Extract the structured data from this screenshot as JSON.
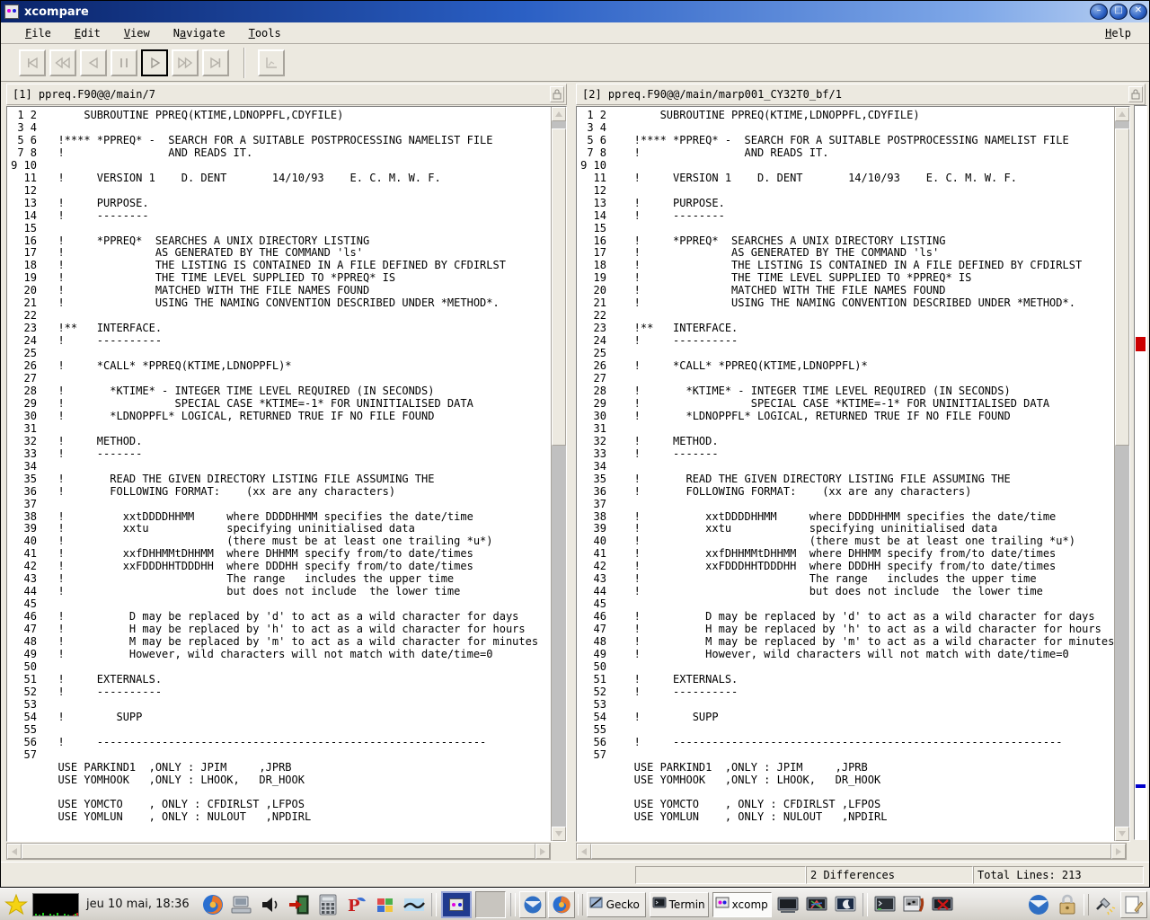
{
  "window": {
    "title": "xcompare",
    "icon": "xcompare-icon",
    "minimize_label": "–",
    "maximize_label": "□",
    "close_label": "✕"
  },
  "menubar": {
    "items": [
      {
        "label": "File",
        "mnemonic": "F",
        "name": "menu-file"
      },
      {
        "label": "Edit",
        "mnemonic": "E",
        "name": "menu-edit"
      },
      {
        "label": "View",
        "mnemonic": "V",
        "name": "menu-view"
      },
      {
        "label": "Navigate",
        "mnemonic": "a",
        "name": "menu-navigate"
      },
      {
        "label": "Tools",
        "mnemonic": "T",
        "name": "menu-tools"
      }
    ],
    "help": {
      "label": "Help",
      "mnemonic": "H",
      "name": "menu-help"
    }
  },
  "toolbar": {
    "buttons": [
      {
        "name": "first-difference-button",
        "icon": "skip-to-start-icon",
        "enabled": false,
        "active": false
      },
      {
        "name": "previous-page-button",
        "icon": "rewind-icon",
        "enabled": false,
        "active": false
      },
      {
        "name": "previous-difference-button",
        "icon": "prev-icon",
        "enabled": false,
        "active": false
      },
      {
        "name": "pause-button",
        "icon": "pause-icon",
        "enabled": false,
        "active": false
      },
      {
        "name": "next-difference-button",
        "icon": "play-icon",
        "enabled": true,
        "active": true
      },
      {
        "name": "next-page-button",
        "icon": "fast-forward-icon",
        "enabled": false,
        "active": false
      },
      {
        "name": "last-difference-button",
        "icon": "skip-to-end-icon",
        "enabled": false,
        "active": false
      },
      {
        "name": "statistics-button",
        "icon": "chart-icon",
        "enabled": false,
        "active": false
      }
    ]
  },
  "panes": [
    {
      "id": "left",
      "name": "pane-left",
      "title": "[1] ppreq.F90@@/main/7",
      "lock_icon": "lock-icon",
      "scroll": {
        "thumb_top_pct": 1,
        "thumb_height_pct": 45
      },
      "first_line": 1,
      "lines": [
        "      SUBROUTINE PPREQ(KTIME,LDNOPPFL,CDYFILE)",
        "",
        "  !**** *PPREQ* -  SEARCH FOR A SUITABLE POSTPROCESSING NAMELIST FILE",
        "  !                AND READS IT.",
        "",
        "  !     VERSION 1    D. DENT       14/10/93    E. C. M. W. F.",
        "",
        "  !     PURPOSE.",
        "  !     --------",
        "",
        "  !     *PPREQ*  SEARCHES A UNIX DIRECTORY LISTING",
        "  !              AS GENERATED BY THE COMMAND 'ls'",
        "  !              THE LISTING IS CONTAINED IN A FILE DEFINED BY CFDIRLST",
        "  !              THE TIME LEVEL SUPPLIED TO *PPREQ* IS",
        "  !              MATCHED WITH THE FILE NAMES FOUND",
        "  !              USING THE NAMING CONVENTION DESCRIBED UNDER *METHOD*.",
        "",
        "  !**   INTERFACE.",
        "  !     ----------",
        "",
        "  !     *CALL* *PPREQ(KTIME,LDNOPPFL)*",
        "",
        "  !       *KTIME* - INTEGER TIME LEVEL REQUIRED (IN SECONDS)",
        "  !                 SPECIAL CASE *KTIME=-1* FOR UNINITIALISED DATA",
        "  !       *LDNOPPFL* LOGICAL, RETURNED TRUE IF NO FILE FOUND",
        "",
        "  !     METHOD.",
        "  !     -------",
        "",
        "  !       READ THE GIVEN DIRECTORY LISTING FILE ASSUMING THE",
        "  !       FOLLOWING FORMAT:    (xx are any characters)",
        "",
        "  !         xxtDDDDHHMM     where DDDDHHMM specifies the date/time",
        "  !         xxtu            specifying uninitialised data",
        "  !                         (there must be at least one trailing *u*)",
        "  !         xxfDHHMMtDHHMM  where DHHMM specify from/to date/times",
        "  !         xxFDDDHHTDDDHH  where DDDHH specify from/to date/times",
        "  !                         The range   includes the upper time",
        "  !                         but does not include  the lower time",
        "",
        "  !          D may be replaced by 'd' to act as a wild character for days",
        "  !          H may be replaced by 'h' to act as a wild character for hours",
        "  !          M may be replaced by 'm' to act as a wild character for minutes",
        "  !          However, wild characters will not match with date/time=0",
        "",
        "  !     EXTERNALS.",
        "  !     ----------",
        "",
        "  !        SUPP",
        "",
        "  !     ------------------------------------------------------------",
        "",
        "  USE PARKIND1  ,ONLY : JPIM     ,JPRB",
        "  USE YOMHOOK   ,ONLY : LHOOK,   DR_HOOK",
        "",
        "  USE YOMCTO    , ONLY : CFDIRLST ,LFPOS",
        "  USE YOMLUN    , ONLY : NULOUT   ,NPDIRL"
      ]
    },
    {
      "id": "right",
      "name": "pane-right",
      "title": "[2] ppreq.F90@@/main/marp001_CY32T0_bf/1",
      "lock_icon": "lock-icon",
      "scroll": {
        "thumb_top_pct": 1,
        "thumb_height_pct": 45
      },
      "first_line": 1,
      "lines": [
        "       SUBROUTINE PPREQ(KTIME,LDNOPPFL,CDYFILE)",
        "",
        "   !**** *PPREQ* -  SEARCH FOR A SUITABLE POSTPROCESSING NAMELIST FILE",
        "   !                AND READS IT.",
        "",
        "   !     VERSION 1    D. DENT       14/10/93    E. C. M. W. F.",
        "",
        "   !     PURPOSE.",
        "   !     --------",
        "",
        "   !     *PPREQ*  SEARCHES A UNIX DIRECTORY LISTING",
        "   !              AS GENERATED BY THE COMMAND 'ls'",
        "   !              THE LISTING IS CONTAINED IN A FILE DEFINED BY CFDIRLST",
        "   !              THE TIME LEVEL SUPPLIED TO *PPREQ* IS",
        "   !              MATCHED WITH THE FILE NAMES FOUND",
        "   !              USING THE NAMING CONVENTION DESCRIBED UNDER *METHOD*.",
        "",
        "   !**   INTERFACE.",
        "   !     ----------",
        "",
        "   !     *CALL* *PPREQ(KTIME,LDNOPPFL)*",
        "",
        "   !       *KTIME* - INTEGER TIME LEVEL REQUIRED (IN SECONDS)",
        "   !                 SPECIAL CASE *KTIME=-1* FOR UNINITIALISED DATA",
        "   !       *LDNOPPFL* LOGICAL, RETURNED TRUE IF NO FILE FOUND",
        "",
        "   !     METHOD.",
        "   !     -------",
        "",
        "   !       READ THE GIVEN DIRECTORY LISTING FILE ASSUMING THE",
        "   !       FOLLOWING FORMAT:    (xx are any characters)",
        "",
        "   !          xxtDDDDHHMM     where DDDDHHMM specifies the date/time",
        "   !          xxtu            specifying uninitialised data",
        "   !                          (there must be at least one trailing *u*)",
        "   !          xxfDHHMMtDHHMM  where DHHMM specify from/to date/times",
        "   !          xxFDDDHHTDDDHH  where DDDHH specify from/to date/times",
        "   !                          The range   includes the upper time",
        "   !                          but does not include  the lower time",
        "",
        "   !          D may be replaced by 'd' to act as a wild character for days",
        "   !          H may be replaced by 'h' to act as a wild character for hours",
        "   !          M may be replaced by 'm' to act as a wild character for minutes",
        "   !          However, wild characters will not match with date/time=0",
        "",
        "   !     EXTERNALS.",
        "   !     ----------",
        "",
        "   !        SUPP",
        "",
        "   !     ------------------------------------------------------------",
        "",
        "   USE PARKIND1  ,ONLY : JPIM     ,JPRB",
        "   USE YOMHOOK   ,ONLY : LHOOK,   DR_HOOK",
        "",
        "   USE YOMCTO    , ONLY : CFDIRLST ,LFPOS",
        "   USE YOMLUN    , ONLY : NULOUT   ,NPDIRL"
      ]
    }
  ],
  "diffmap": {
    "name": "difference-map",
    "markers": [
      {
        "name": "difference-marker-red",
        "color": "#cc0000",
        "top_pct": 31.5,
        "height_pct": 2.0
      },
      {
        "name": "difference-marker-blue",
        "color": "#0000cc",
        "top_pct": 92.5,
        "height_pct": 0.5
      }
    ]
  },
  "statusbar": {
    "blank": "",
    "differences": "2 Differences",
    "total_lines": "Total Lines:  213"
  },
  "taskbar": {
    "menu_icon": "star-menu-icon",
    "monitor_icon": "system-monitor-icon",
    "clock": "jeu 10 mai, 18:36",
    "launchers_left": [
      {
        "name": "firefox-launcher-icon",
        "icon": "firefox-icon"
      },
      {
        "name": "computer-launcher-icon",
        "icon": "computer-icon"
      },
      {
        "name": "volume-launcher-icon",
        "icon": "speaker-icon"
      },
      {
        "name": "logout-launcher-icon",
        "icon": "exit-door-icon"
      },
      {
        "name": "calculator-launcher-icon",
        "icon": "calculator-icon"
      },
      {
        "name": "ghostscript-launcher-icon",
        "icon": "ghostscript-icon"
      },
      {
        "name": "windows-launcher-icon",
        "icon": "windows-icon"
      },
      {
        "name": "gimp-launcher-icon",
        "icon": "swoosh-icon"
      }
    ],
    "pagers": [
      {
        "name": "workspace-1",
        "active": true
      },
      {
        "name": "workspace-2",
        "active": false
      }
    ],
    "tray_left": [
      {
        "name": "thunderbird-tray-icon",
        "icon": "thunderbird-icon"
      },
      {
        "name": "firefox-tray-icon",
        "icon": "firefox-icon"
      }
    ],
    "windows": [
      {
        "name": "taskbar-window-gecko",
        "label": "Gecko",
        "icon": "gecko-icon",
        "active": false
      },
      {
        "name": "taskbar-window-terminal",
        "label": "Termin",
        "icon": "terminal-icon",
        "active": false
      },
      {
        "name": "taskbar-window-xcompare",
        "label": "xcomp",
        "icon": "xcompare-icon",
        "active": true
      }
    ],
    "launchers_right": [
      {
        "name": "terminal-launcher-icon",
        "icon": "terminal-icon"
      },
      {
        "name": "xterm-color-launcher-icon",
        "icon": "xterm-color-icon"
      },
      {
        "name": "screensaver-launcher-icon",
        "icon": "moon-icon"
      },
      {
        "name": "console-launcher-icon",
        "icon": "console-icon"
      },
      {
        "name": "music-launcher-icon",
        "icon": "music-icon"
      },
      {
        "name": "close-terminal-launcher-icon",
        "icon": "terminal-close-icon"
      }
    ],
    "tray_right": [
      {
        "name": "thunderbird-status-icon",
        "icon": "thunderbird-icon"
      },
      {
        "name": "lock-screen-icon",
        "icon": "padlock-icon"
      },
      {
        "name": "unplugged-icon",
        "icon": "plug-icon"
      },
      {
        "name": "notes-icon",
        "icon": "notepad-icon"
      }
    ]
  }
}
